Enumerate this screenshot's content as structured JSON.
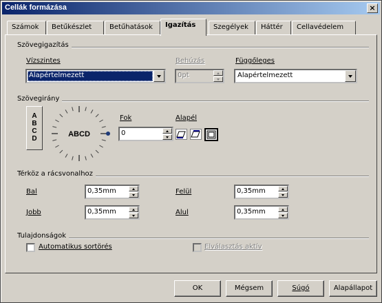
{
  "window": {
    "title": "Cellák formázása",
    "close_label": "×"
  },
  "tabs": [
    {
      "label": "Számok"
    },
    {
      "label": "Betűkészlet"
    },
    {
      "label": "Betűhatások"
    },
    {
      "label": "Igazítás"
    },
    {
      "label": "Szegélyek"
    },
    {
      "label": "Háttér"
    },
    {
      "label": "Cellavédelem"
    }
  ],
  "active_tab": "Igazítás",
  "text_alignment": {
    "title": "Szövegigazítás",
    "horizontal_label": "Vízszintes",
    "horizontal_value": "Alapértelmezett",
    "indent_label": "Behúzás",
    "indent_value": "0pt",
    "vertical_label": "Függőleges",
    "vertical_value": "Alapértelmezett"
  },
  "text_direction": {
    "title": "Szövegirány",
    "vertical_stack_letters": "A\nB\nC\nD",
    "dial_text": "ABCD",
    "degrees_label": "Fok",
    "degrees_value": "0",
    "reference_edge_label": "Alapél"
  },
  "spacing": {
    "title": "Térköz a rácsvonalhoz",
    "left_label": "Bal",
    "left_value": "0,35mm",
    "top_label": "Felül",
    "top_value": "0,35mm",
    "right_label": "Jobb",
    "right_value": "0,35mm",
    "bottom_label": "Alul",
    "bottom_value": "0,35mm"
  },
  "properties": {
    "title": "Tulajdonságok",
    "wrap_label": "Automatikus sortörés",
    "wrap_checked": false,
    "hyphenation_label": "Elválasztás aktív",
    "hyphenation_checked": false
  },
  "buttons": {
    "ok": "OK",
    "cancel": "Mégsem",
    "help": "Súgó",
    "reset": "Alapállapot"
  },
  "colors": {
    "titlebar_start": "#0a246a",
    "titlebar_end": "#a6caf0",
    "face": "#d4d0c8",
    "selection": "#0a246a",
    "dial_marker": "#1e3a78"
  }
}
